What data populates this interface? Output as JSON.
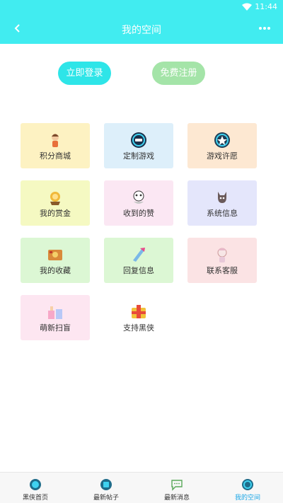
{
  "status_bar": {
    "time": "11:44"
  },
  "header": {
    "title": "我的空间"
  },
  "auth": {
    "login_label": "立即登录",
    "register_label": "免费注册"
  },
  "colors": {
    "accent": "#41ecf0",
    "login_button": "#2ee5e8",
    "register_button": "#a4e4a8",
    "tab_active": "#1aa6e6"
  },
  "grid": {
    "items": [
      {
        "label": "积分商城",
        "icon": "character-icon",
        "bg": "#fdf2c2"
      },
      {
        "label": "定制游戏",
        "icon": "custom-game-icon",
        "bg": "#ddeffa"
      },
      {
        "label": "游戏许愿",
        "icon": "wish-icon",
        "bg": "#fde8d2"
      },
      {
        "label": "我的赏金",
        "icon": "reward-icon",
        "bg": "#f5f9c2"
      },
      {
        "label": "收到的赞",
        "icon": "likes-icon",
        "bg": "#fbe7f3"
      },
      {
        "label": "系统信息",
        "icon": "system-info-icon",
        "bg": "#e4e6fb"
      },
      {
        "label": "我的收藏",
        "icon": "favorites-icon",
        "bg": "#dcf7d4"
      },
      {
        "label": "回复信息",
        "icon": "reply-icon",
        "bg": "#dcf7d4"
      },
      {
        "label": "联系客服",
        "icon": "customer-service-icon",
        "bg": "#fbe3e4"
      },
      {
        "label": "萌新扫盲",
        "icon": "newbie-guide-icon",
        "bg": "#fde6f1"
      },
      {
        "label": "支持黑侠",
        "icon": "support-icon",
        "bg": "#ffffff"
      }
    ]
  },
  "tabbar": {
    "tabs": [
      {
        "label": "黑侠首页",
        "icon": "home-icon"
      },
      {
        "label": "最新帖子",
        "icon": "posts-icon"
      },
      {
        "label": "最新消息",
        "icon": "message-icon"
      },
      {
        "label": "我的空间",
        "icon": "space-icon",
        "active": true
      }
    ]
  }
}
